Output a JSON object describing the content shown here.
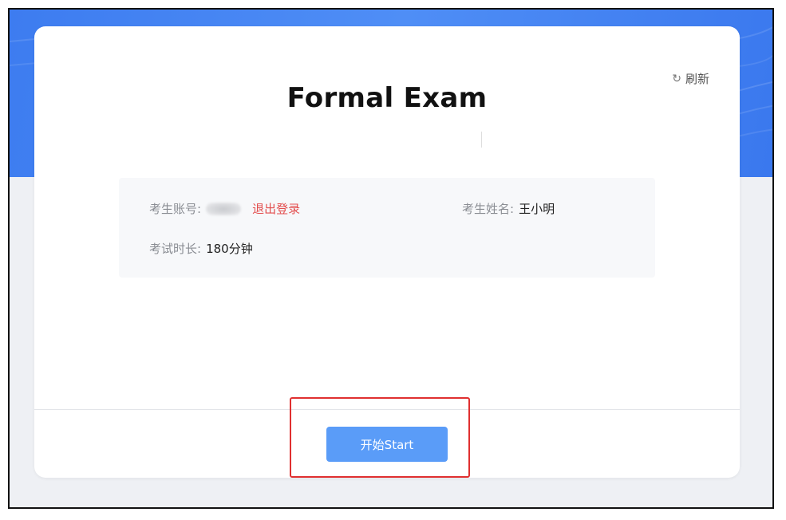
{
  "header": {
    "title": "Formal Exam",
    "refresh_label": "刷新",
    "refresh_icon": "refresh-icon"
  },
  "info": {
    "account_label": "考生账号:",
    "logout_label": "退出登录",
    "name_label": "考生姓名:",
    "name_value": "王小明",
    "duration_label": "考试时长:",
    "duration_value": "180分钟"
  },
  "actions": {
    "start_label": "开始Start"
  },
  "colors": {
    "banner": "#4f8ef6",
    "button": "#5a9cf8",
    "logout": "#e34d4d",
    "highlight": "#e03030"
  }
}
